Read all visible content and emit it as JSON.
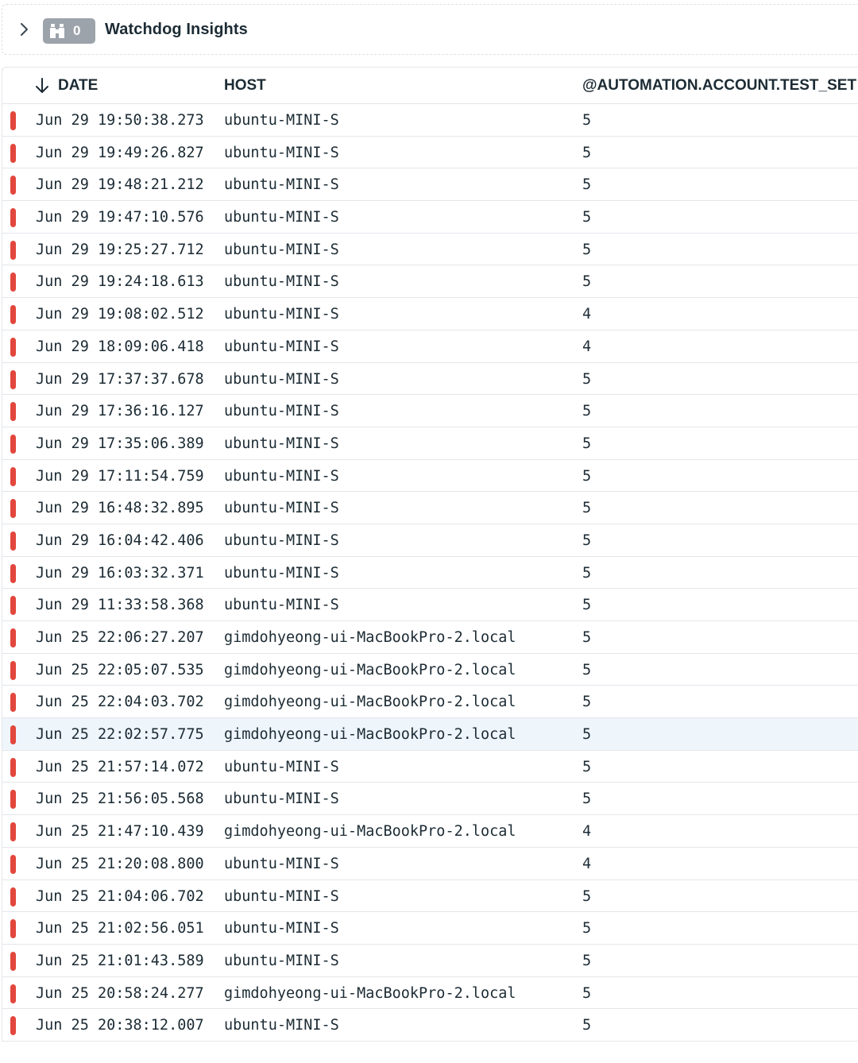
{
  "insights": {
    "count": "0",
    "title": "Watchdog Insights",
    "colors": {
      "badge": "#9da3ab"
    }
  },
  "table": {
    "columns": {
      "date": "DATE",
      "host": "HOST",
      "attr": "@AUTOMATION.ACCOUNT.TEST_SET"
    },
    "sort": "descending",
    "status_color": "#e2473d",
    "highlight_color": "#eef5fb",
    "rows": [
      {
        "date": "Jun 29 19:50:38.273",
        "host": "ubuntu-MINI-S",
        "value": "5"
      },
      {
        "date": "Jun 29 19:49:26.827",
        "host": "ubuntu-MINI-S",
        "value": "5"
      },
      {
        "date": "Jun 29 19:48:21.212",
        "host": "ubuntu-MINI-S",
        "value": "5"
      },
      {
        "date": "Jun 29 19:47:10.576",
        "host": "ubuntu-MINI-S",
        "value": "5"
      },
      {
        "date": "Jun 29 19:25:27.712",
        "host": "ubuntu-MINI-S",
        "value": "5"
      },
      {
        "date": "Jun 29 19:24:18.613",
        "host": "ubuntu-MINI-S",
        "value": "5"
      },
      {
        "date": "Jun 29 19:08:02.512",
        "host": "ubuntu-MINI-S",
        "value": "4"
      },
      {
        "date": "Jun 29 18:09:06.418",
        "host": "ubuntu-MINI-S",
        "value": "4"
      },
      {
        "date": "Jun 29 17:37:37.678",
        "host": "ubuntu-MINI-S",
        "value": "5"
      },
      {
        "date": "Jun 29 17:36:16.127",
        "host": "ubuntu-MINI-S",
        "value": "5"
      },
      {
        "date": "Jun 29 17:35:06.389",
        "host": "ubuntu-MINI-S",
        "value": "5"
      },
      {
        "date": "Jun 29 17:11:54.759",
        "host": "ubuntu-MINI-S",
        "value": "5"
      },
      {
        "date": "Jun 29 16:48:32.895",
        "host": "ubuntu-MINI-S",
        "value": "5"
      },
      {
        "date": "Jun 29 16:04:42.406",
        "host": "ubuntu-MINI-S",
        "value": "5"
      },
      {
        "date": "Jun 29 16:03:32.371",
        "host": "ubuntu-MINI-S",
        "value": "5"
      },
      {
        "date": "Jun 29 11:33:58.368",
        "host": "ubuntu-MINI-S",
        "value": "5"
      },
      {
        "date": "Jun 25 22:06:27.207",
        "host": "gimdohyeong-ui-MacBookPro-2.local",
        "value": "5"
      },
      {
        "date": "Jun 25 22:05:07.535",
        "host": "gimdohyeong-ui-MacBookPro-2.local",
        "value": "5"
      },
      {
        "date": "Jun 25 22:04:03.702",
        "host": "gimdohyeong-ui-MacBookPro-2.local",
        "value": "5"
      },
      {
        "date": "Jun 25 22:02:57.775",
        "host": "gimdohyeong-ui-MacBookPro-2.local",
        "value": "5",
        "highlighted": true
      },
      {
        "date": "Jun 25 21:57:14.072",
        "host": "ubuntu-MINI-S",
        "value": "5"
      },
      {
        "date": "Jun 25 21:56:05.568",
        "host": "ubuntu-MINI-S",
        "value": "5"
      },
      {
        "date": "Jun 25 21:47:10.439",
        "host": "gimdohyeong-ui-MacBookPro-2.local",
        "value": "4"
      },
      {
        "date": "Jun 25 21:20:08.800",
        "host": "ubuntu-MINI-S",
        "value": "4"
      },
      {
        "date": "Jun 25 21:04:06.702",
        "host": "ubuntu-MINI-S",
        "value": "5"
      },
      {
        "date": "Jun 25 21:02:56.051",
        "host": "ubuntu-MINI-S",
        "value": "5"
      },
      {
        "date": "Jun 25 21:01:43.589",
        "host": "ubuntu-MINI-S",
        "value": "5"
      },
      {
        "date": "Jun 25 20:58:24.277",
        "host": "gimdohyeong-ui-MacBookPro-2.local",
        "value": "5"
      },
      {
        "date": "Jun 25 20:38:12.007",
        "host": "ubuntu-MINI-S",
        "value": "5"
      }
    ]
  },
  "icons": {
    "expand": "chevron-right-icon",
    "insights": "binoculars-icon",
    "sort": "arrow-down-icon"
  }
}
